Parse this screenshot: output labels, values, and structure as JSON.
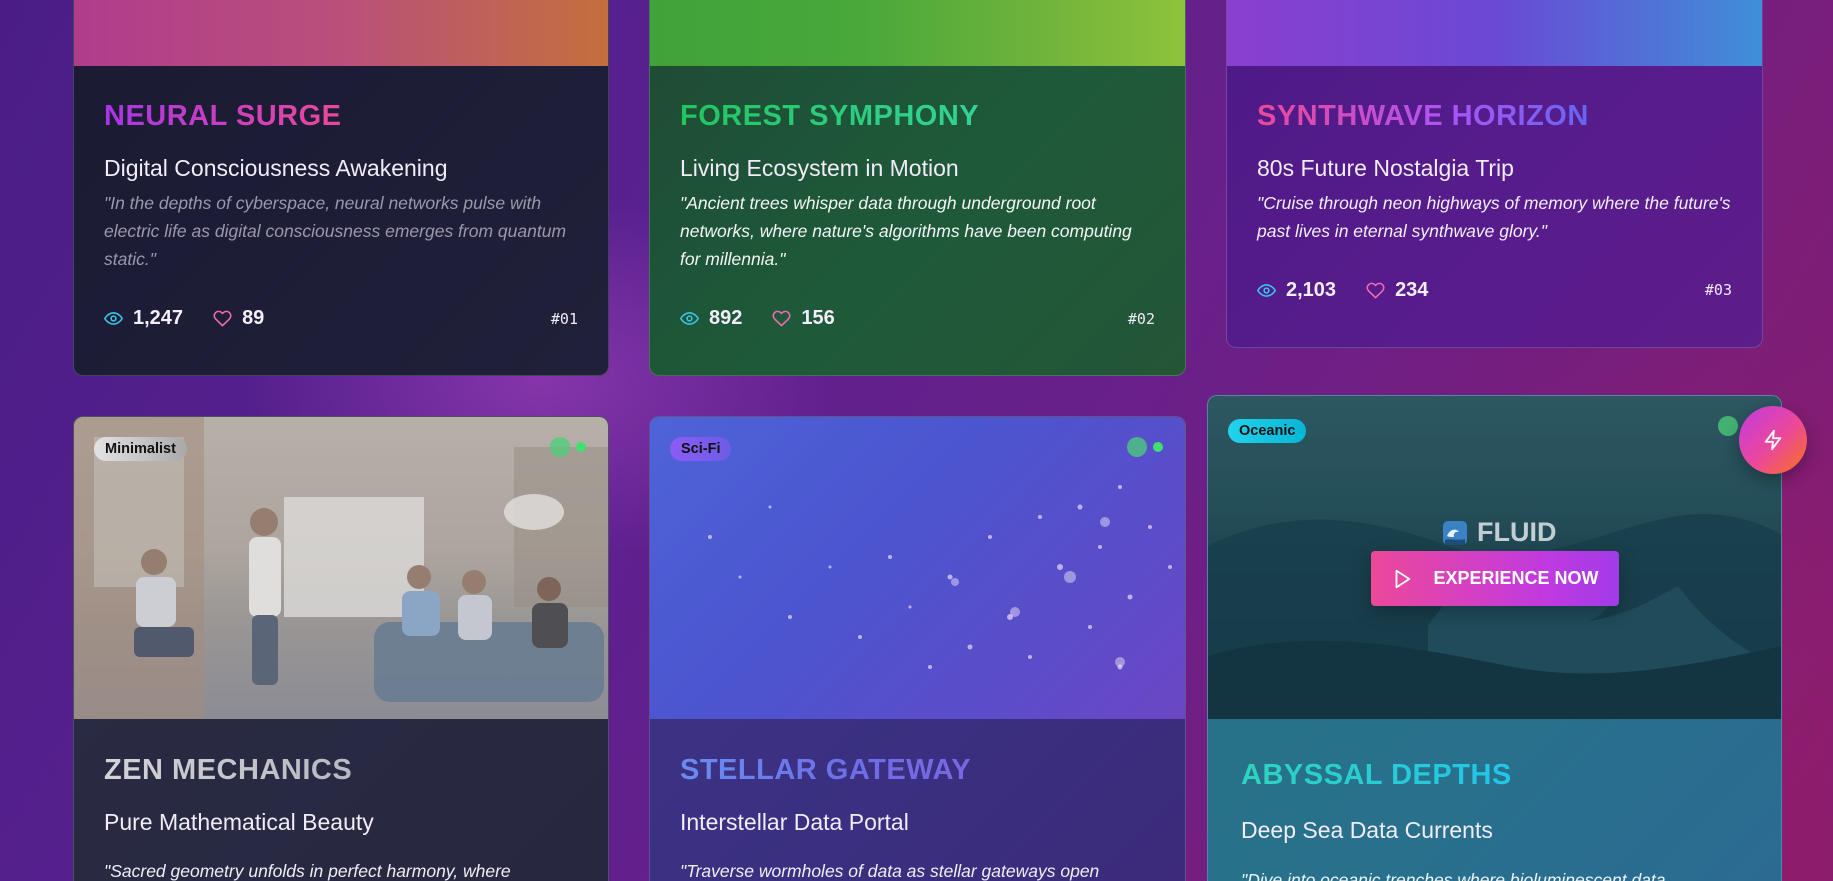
{
  "colors": {
    "eye_icon": "#38c5e8",
    "heart_icon": "#f06ab0",
    "accent_pink": "#ec4899",
    "accent_purple": "#a855f7",
    "status_green": "#4cd07a"
  },
  "cards": [
    {
      "title": "NEURAL SURGE",
      "subtitle": "Digital Consciousness Awakening",
      "description": "\"In the depths of cyberspace, neural networks pulse with electric life as digital consciousness emerges from quantum static.\"",
      "views": "1,247",
      "likes": "89",
      "id": "#01"
    },
    {
      "title": "FOREST SYMPHONY",
      "subtitle": "Living Ecosystem in Motion",
      "description": "\"Ancient trees whisper data through underground root networks, where nature's algorithms have been computing for millennia.\"",
      "views": "892",
      "likes": "156",
      "id": "#02"
    },
    {
      "title": "SYNTHWAVE HORIZON",
      "subtitle": "80s Future Nostalgia Trip",
      "description": "\"Cruise through neon highways of memory where the future's past lives in eternal synthwave glory.\"",
      "views": "2,103",
      "likes": "234",
      "id": "#03"
    },
    {
      "tag": "Minimalist",
      "title": "ZEN MECHANICS",
      "subtitle": "Pure Mathematical Beauty",
      "description": "\"Sacred geometry unfolds in perfect harmony, where simplicity"
    },
    {
      "tag": "Sci-Fi",
      "title": "STELLAR GATEWAY",
      "subtitle": "Interstellar Data Portal",
      "description": "\"Traverse wormholes of data as stellar gateways open"
    },
    {
      "tag": "Oceanic",
      "overlay_label": "FLUID",
      "cta_label": "EXPERIENCE NOW",
      "title": "ABYSSAL DEPTHS",
      "subtitle": "Deep Sea Data Currents",
      "description": "\"Dive into oceanic trenches where bioluminescent data"
    }
  ]
}
